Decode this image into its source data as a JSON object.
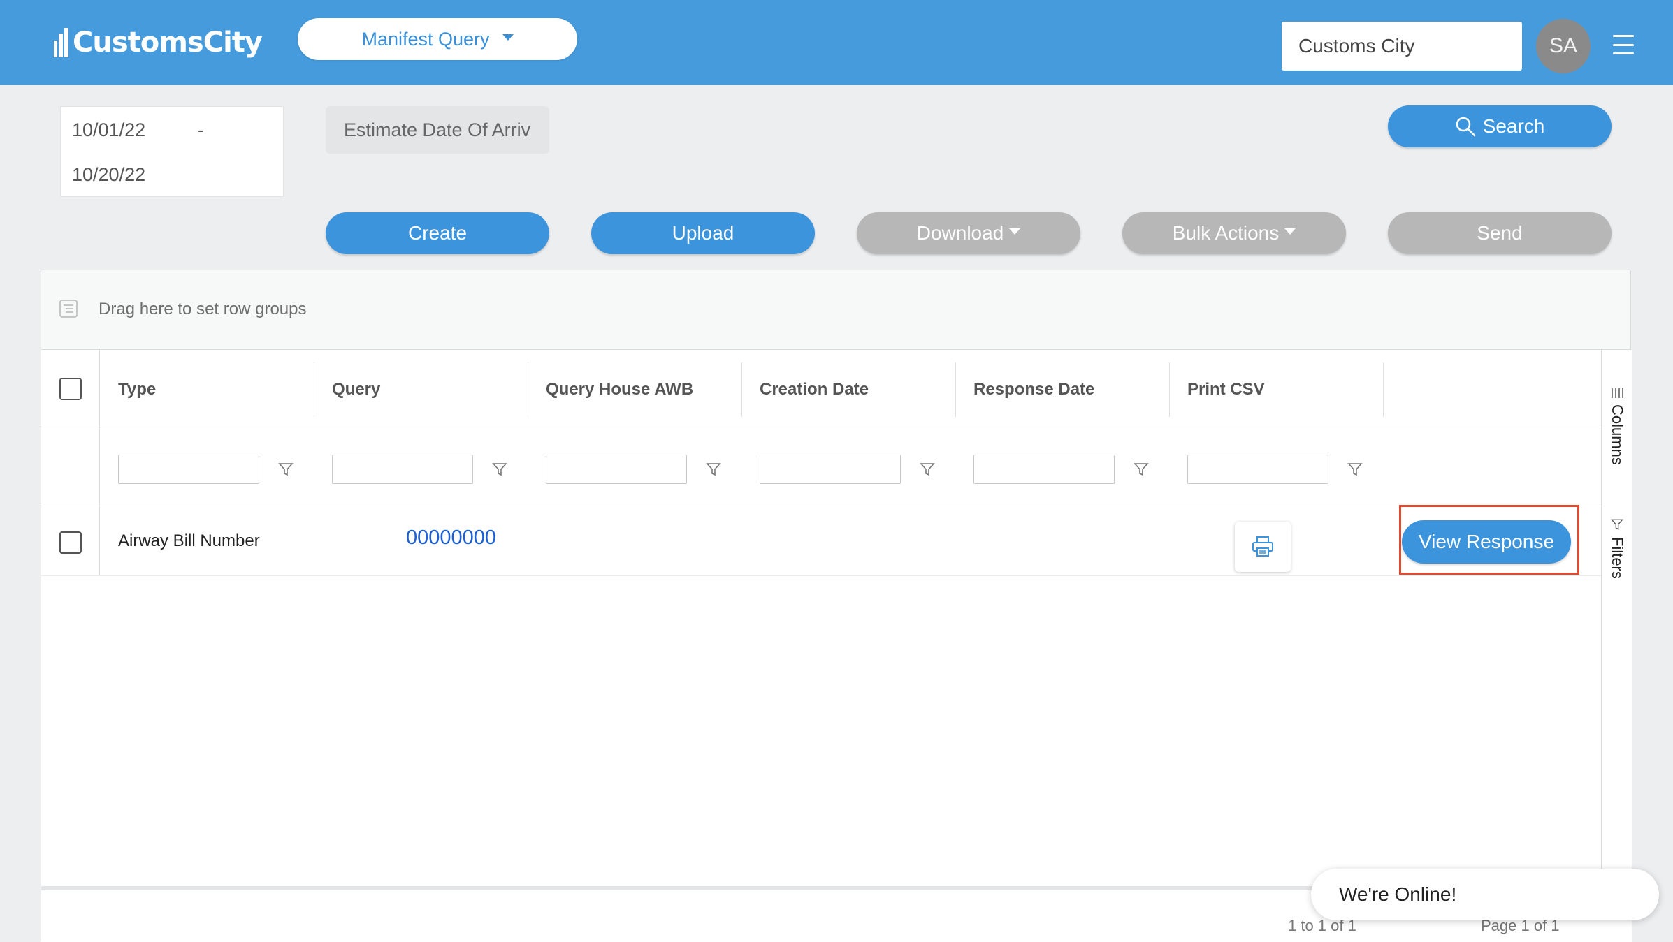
{
  "header": {
    "logo_text": "CustomsCity",
    "module_label": "Manifest Query",
    "company_value": "Customs City",
    "avatar_initials": "SA",
    "brand_color": "#469bdc"
  },
  "filters": {
    "date_from": "10/01/22",
    "date_sep": "-",
    "date_to": "10/20/22",
    "date_type": "Estimate Date Of Arriv",
    "search_label": "Search"
  },
  "actions": {
    "create": "Create",
    "upload": "Upload",
    "download": "Download",
    "bulk_actions": "Bulk Actions",
    "send": "Send"
  },
  "grid": {
    "group_panel_text": "Drag here to set row groups",
    "columns": [
      "Type",
      "Query",
      "Query House AWB",
      "Creation Date",
      "Response Date",
      "Print CSV"
    ],
    "rows": [
      {
        "type": "Airway Bill Number",
        "query": "00000000",
        "query_house_awb": "",
        "creation_date": "",
        "response_date": "",
        "action_label": "View Response"
      }
    ],
    "side_tabs": {
      "columns": "Columns",
      "filters": "Filters"
    },
    "paging_text": "1 to 1 of 1",
    "page_text": "Page 1 of 1"
  },
  "chat": {
    "label": "We're Online!"
  },
  "colors": {
    "accent": "#3b94dc",
    "disabled": "#b7b7b7",
    "link": "#1c5fd4",
    "highlight": "#e2492f"
  }
}
